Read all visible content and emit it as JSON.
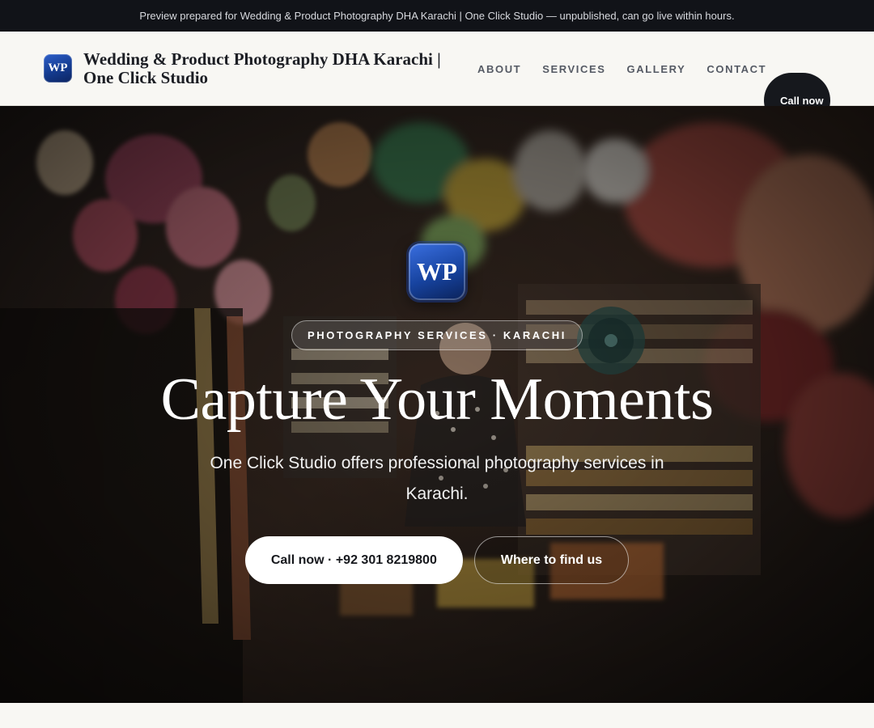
{
  "preview_bar": {
    "text": "Preview prepared for Wedding & Product Photography DHA Karachi | One Click Studio — unpublished, can go live within hours."
  },
  "header": {
    "logo_initials": "WP",
    "site_title": "Wedding & Product Photography DHA Karachi | One Click Studio",
    "nav": [
      {
        "label": "ABOUT"
      },
      {
        "label": "SERVICES"
      },
      {
        "label": "GALLERY"
      },
      {
        "label": "CONTACT"
      }
    ],
    "call_button": "Call now"
  },
  "hero": {
    "logo_initials": "WP",
    "eyebrow": "PHOTOGRAPHY SERVICES · KARACHI",
    "title": "Capture Your Moments",
    "subtitle": "One Click Studio offers professional photography services in Karachi.",
    "primary_cta": "Call now · +92 301 8219800",
    "secondary_cta": "Where to find us"
  },
  "colors": {
    "accent_dark": "#16181d",
    "logo_blue": "#17439f",
    "preview_bar_bg": "#111318",
    "page_bg": "#f8f7f3"
  }
}
